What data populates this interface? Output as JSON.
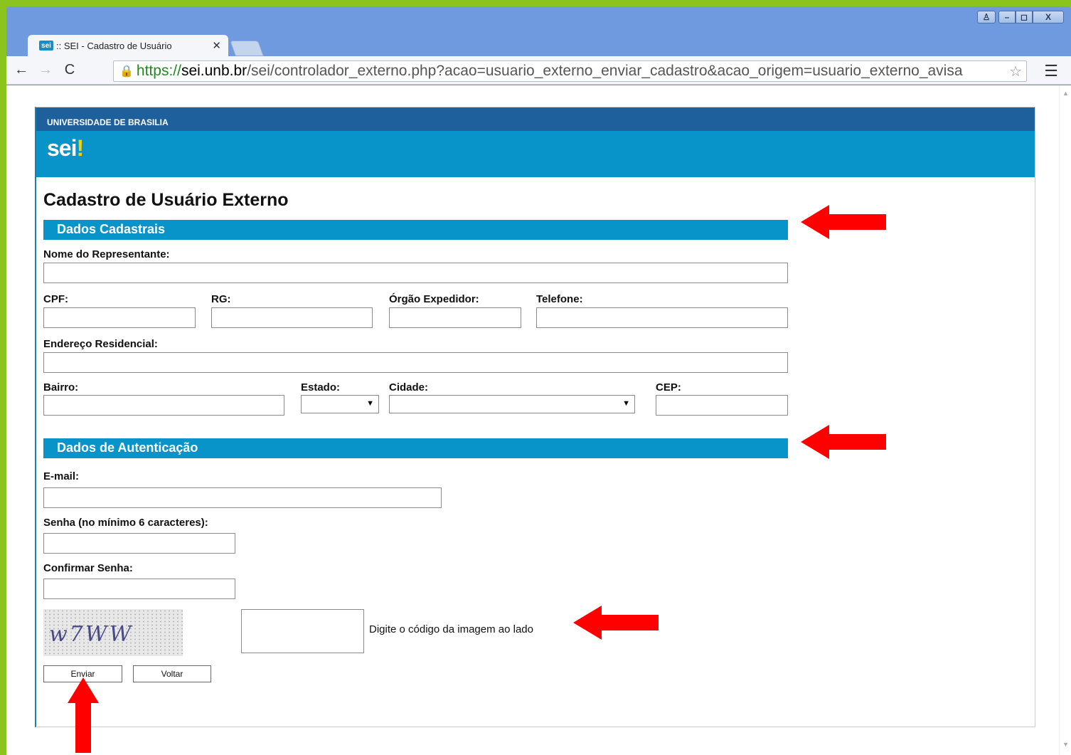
{
  "browser": {
    "tab_title": ":: SEI - Cadastro de Usuário",
    "tab_favicon_text": "sei",
    "url_scheme": "https://",
    "url_host": "sei.unb.br",
    "url_path": "/sei/controlador_externo.php?acao=usuario_externo_enviar_cadastro&acao_origem=usuario_externo_avisa"
  },
  "header": {
    "org_name": "UNIVERSIDADE DE BRASILIA",
    "logo_text": "sei",
    "logo_mark": "!"
  },
  "form": {
    "page_title": "Cadastro de Usuário Externo",
    "section_personal": "Dados Cadastrais",
    "section_auth": "Dados de Autenticação",
    "labels": {
      "nome": "Nome do Representante:",
      "cpf": "CPF:",
      "rg": "RG:",
      "orgao": "Órgão Expedidor:",
      "telefone": "Telefone:",
      "endereco": "Endereço Residencial:",
      "bairro": "Bairro:",
      "estado": "Estado:",
      "cidade": "Cidade:",
      "cep": "CEP:",
      "email": "E-mail:",
      "senha": "Senha (no mínimo 6 caracteres):",
      "confirmar": "Confirmar Senha:"
    },
    "captcha_text": "w7WW",
    "captcha_hint": "Digite o código da imagem ao lado",
    "buttons": {
      "enviar": "Enviar",
      "voltar": "Voltar"
    }
  },
  "colors": {
    "frame": "#8cc41e",
    "org_bar": "#1d609c",
    "brand": "#0893c9",
    "annotation": "#ff0000"
  }
}
